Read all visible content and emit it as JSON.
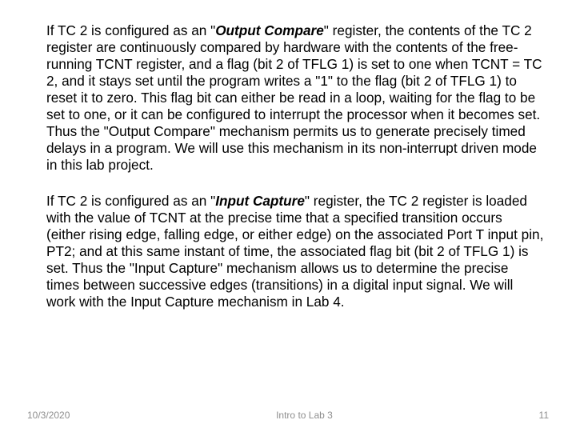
{
  "body": {
    "para1": {
      "pre": "If TC 2 is configured as an \"",
      "emph": "Output Compare",
      "post": "\" register, the contents of the TC 2 register are continuously compared by hardware with the contents of the free-running TCNT register, and a flag (bit 2 of TFLG 1) is set to one when TCNT = TC 2, and it stays set until the program writes a \"1\" to the flag (bit 2 of TFLG 1) to reset it to zero.  This flag bit can either be read in a loop, waiting for the flag to be set to one, or it can be configured to interrupt the processor when it becomes set.  Thus the \"Output Compare\" mechanism permits us to generate precisely timed delays in a program.  We will use this mechanism in its non-interrupt driven mode in this lab project."
    },
    "para2": {
      "pre": "If TC 2 is configured as an \"",
      "emph": "Input Capture",
      "post": "\" register, the TC 2 register is loaded with the value of TCNT at the precise time that a specified transition occurs (either rising edge, falling edge, or either edge) on the associated Port T input pin, PT2; and at this same instant of time, the associated flag bit (bit 2 of TFLG 1) is set.   Thus the \"Input Capture\" mechanism allows us to determine the precise times between successive edges (transitions) in a digital input signal.  We will work with the Input Capture mechanism in Lab 4."
    }
  },
  "footer": {
    "date": "10/3/2020",
    "title": "Intro to Lab 3",
    "page": "11"
  }
}
